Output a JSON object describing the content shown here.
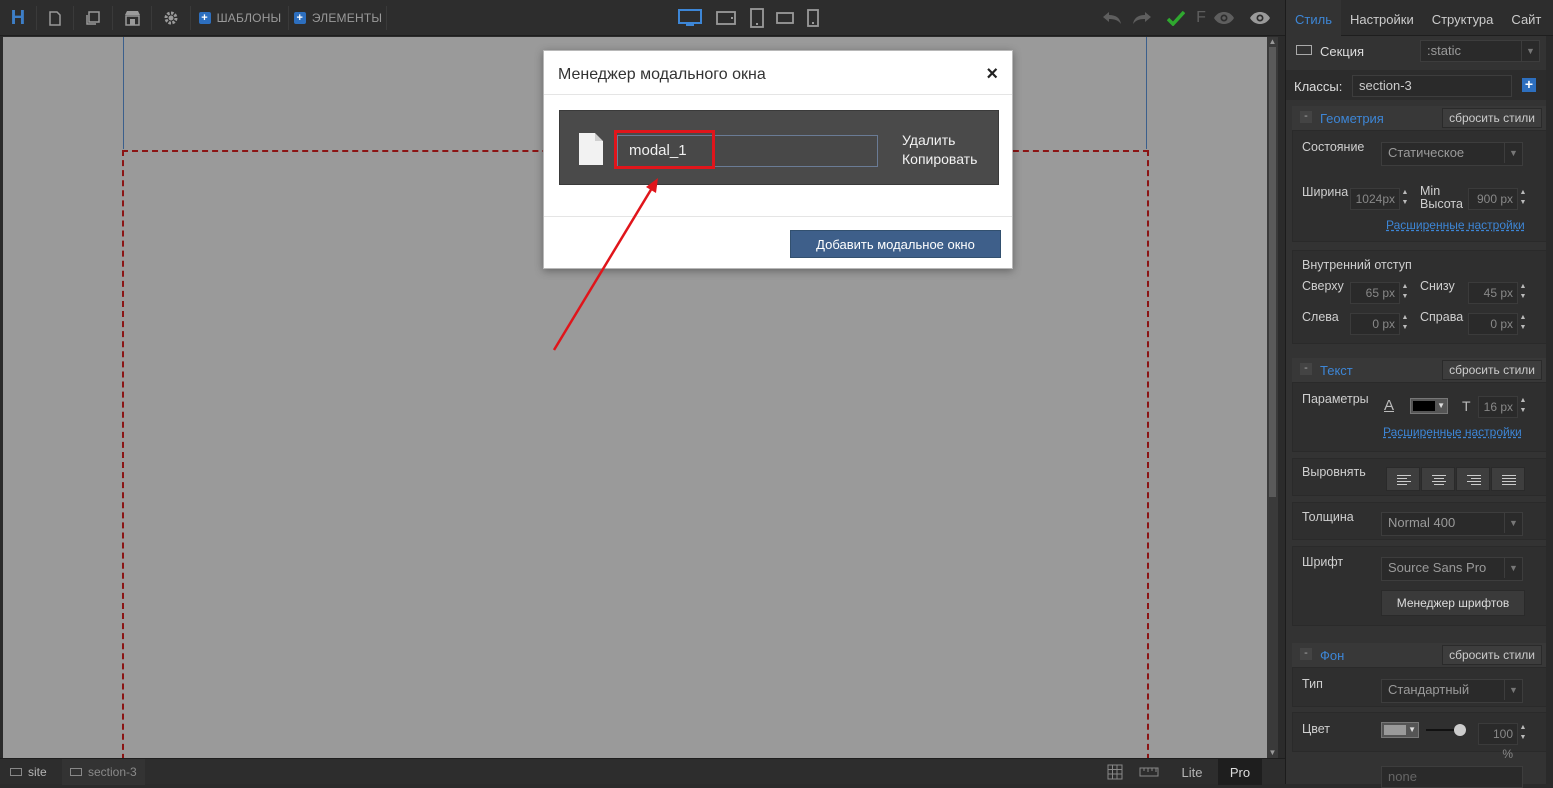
{
  "toolbar": {
    "logo": "H",
    "templates_label": "ШАБЛОНЫ",
    "elements_label": "ЭЛЕМЕНТЫ",
    "pro_f": "F"
  },
  "modal": {
    "title": "Менеджер модального окна",
    "close": "×",
    "item_name": "modal_1",
    "delete_label": "Удалить",
    "copy_label": "Копировать",
    "add_button": "Добавить модальное окно"
  },
  "bottombar": {
    "crumb_site": "site",
    "crumb_section": "section-3",
    "lite": "Lite",
    "pro": "Pro"
  },
  "panel": {
    "tabs": [
      "Стиль",
      "Настройки",
      "Структура",
      "Сайт"
    ],
    "element_label": "Секция",
    "position": ":static",
    "classes_label": "Классы:",
    "class_value": "section-3",
    "geometry": {
      "title": "Геометрия",
      "reset": "сбросить стили",
      "state_label": "Состояние",
      "state_value": "Статическое",
      "width_label": "Ширина",
      "width_value": "1024px",
      "minheight_label": "Min Высота",
      "minheight_value": "900 px",
      "advanced": "Расширенные настройки"
    },
    "padding": {
      "title": "Внутренний отступ",
      "top_label": "Сверху",
      "top_value": "65 px",
      "bottom_label": "Снизу",
      "bottom_value": "45 px",
      "left_label": "Слева",
      "left_value": "0 px",
      "right_label": "Справа",
      "right_value": "0 px"
    },
    "text": {
      "title": "Текст",
      "reset": "сбросить стили",
      "params_label": "Параметры",
      "font_size": "16 px",
      "advanced": "Расширенные настройки",
      "align_label": "Выровнять",
      "weight_label": "Толщина",
      "weight_value": "Normal 400",
      "font_label": "Шрифт",
      "font_value": "Source Sans Pro",
      "font_manager": "Менеджер шрифтов"
    },
    "background": {
      "title": "Фон",
      "reset": "сбросить стили",
      "type_label": "Тип",
      "type_value": "Стандартный",
      "color_label": "Цвет",
      "opacity": "100 %",
      "image_value": "none"
    }
  },
  "colors": {
    "accent": "#3d86d6",
    "highlight": "#e0151b",
    "button": "#3e5f8a",
    "check": "#2fa82f"
  }
}
